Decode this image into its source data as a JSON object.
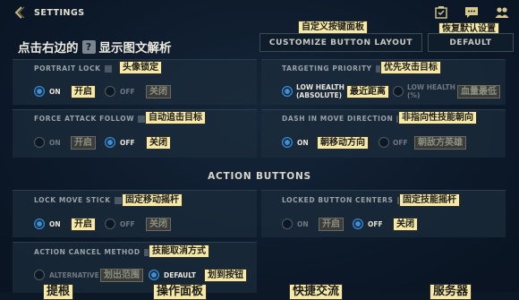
{
  "header": {
    "title": "SETTINGS",
    "customize_label": "CUSTOMIZE BUTTON LAYOUT",
    "customize_ann": "自定义按键面板",
    "default_label": "DEFAULT",
    "default_ann": "恢复默认设置"
  },
  "hint": {
    "before": "点击右边的",
    "help_glyph": "?",
    "after": "显示图文解析"
  },
  "icons": [
    "back-icon",
    "notifications-icon",
    "chat-icon",
    "friends-icon",
    "info-icon"
  ],
  "colors": {
    "accent": "#3a8fd6",
    "annotation_bg": "#f6e9a6"
  },
  "settings": {
    "portrait_lock": {
      "title": "PORTRAIT LOCK",
      "ann": "头像锁定",
      "on": "ON",
      "on_ann": "开启",
      "off": "OFF",
      "off_ann": "关闭",
      "selected": "ON"
    },
    "targeting_priority": {
      "title": "TARGETING PRIORITY",
      "ann": "优先攻击目标",
      "opt1_line1": "LOW HEALTH",
      "opt1_line2": "(ABSOLUTE)",
      "opt1_ann": "最近距离",
      "opt2_line1": "LOW HEALTH",
      "opt2_line2": "(%)",
      "opt2_ann": "血量最低",
      "selected": "LOW HEALTH (ABSOLUTE)"
    },
    "force_attack_follow": {
      "title": "FORCE ATTACK FOLLOW",
      "ann": "自动追击目标",
      "on": "ON",
      "on_ann": "开启",
      "off": "OFF",
      "off_ann": "关闭",
      "selected": "OFF"
    },
    "dash_direction": {
      "title": "DASH IN MOVE DIRECTION",
      "ann": "非指向性技能朝向",
      "on": "ON",
      "on_ann": "朝移动方向",
      "off": "OFF",
      "off_ann": "朝敌方英雄",
      "selected": "ON"
    }
  },
  "section_title": "ACTION BUTTONS",
  "action_buttons": {
    "lock_move_stick": {
      "title": "LOCK MOVE STICK",
      "ann": "固定移动摇杆",
      "on": "ON",
      "on_ann": "开启",
      "off": "OFF",
      "off_ann": "关闭",
      "selected": "ON"
    },
    "locked_button_centers": {
      "title": "LOCKED BUTTON CENTERS",
      "ann": "固定技能摇杆",
      "on": "ON",
      "on_ann": "开启",
      "off": "OFF",
      "off_ann": "关闭",
      "selected": "OFF"
    },
    "action_cancel_method": {
      "title": "ACTION CANCEL METHOD",
      "ann": "技能取消方式",
      "alt": "ALTERNATIVE",
      "alt_ann": "划出范围",
      "def": "DEFAULT",
      "def_ann": "划到按钮",
      "selected": "DEFAULT"
    }
  },
  "bottom_tabs": [
    "提根",
    "操作面板",
    "快捷交流",
    "服务器"
  ]
}
